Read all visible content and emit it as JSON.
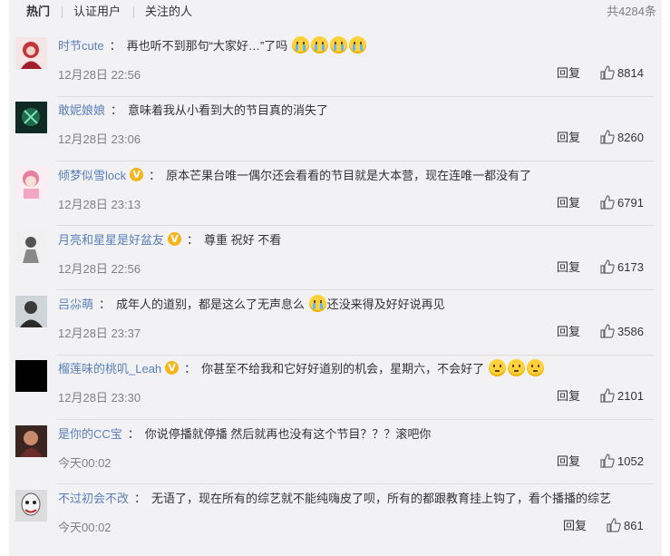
{
  "tabs": {
    "hot": "热门",
    "verified": "认证用户",
    "following": "关注的人",
    "total": "共4284条"
  },
  "icons": {
    "vip": "vip-badge-icon",
    "cry": "crying-face-emoji",
    "think": "thinking-face-emoji",
    "like": "thumbs-up-icon"
  },
  "colors": {
    "username": "#5a7fb8",
    "vip": "#f5b41a",
    "background": "#f2f2f5"
  },
  "reply_label": "回复",
  "comments": [
    {
      "user": "时节cute",
      "text_before": "再也听不到那句“大家好…”了吗",
      "text_after": "",
      "time": "12月28日 22:56",
      "likes": "8814"
    },
    {
      "user": "敢妮娘娘",
      "text_before": "意味着我从小看到大的节目真的消失了",
      "text_after": "",
      "time": "12月28日 23:06",
      "likes": "8260"
    },
    {
      "user": "倾梦似雪lock",
      "text_before": "原本芒果台唯一偶尔还会看看的节目就是大本营，现在连唯一都没有了",
      "text_after": "",
      "time": "12月28日 23:13",
      "likes": "6791"
    },
    {
      "user": "月亮和星星是好盆友",
      "text_before": "尊重 祝好 不看",
      "text_after": "",
      "time": "12月28日 22:56",
      "likes": "6173"
    },
    {
      "user": "吕尛萌",
      "text_before": "成年人的道别，都是这么了无声息么",
      "text_after": "还没来得及好好说再见",
      "time": "12月28日 23:37",
      "likes": "3586"
    },
    {
      "user": "榴莲味的桃叽_Leah",
      "text_before": "你甚至不给我和它好好道别的机会，星期六，不会好了",
      "text_after": "",
      "time": "12月28日 23:30",
      "likes": "2101"
    },
    {
      "user": "是你的CC宝",
      "text_before": "你说停播就停播 然后就再也没有这个节目？？？滚吧你",
      "text_after": "",
      "time": "今天00:02",
      "likes": "1052"
    },
    {
      "user": "不过初会不改",
      "text_before": "无语了，现在所有的综艺就不能纯嗨皮了呗，所有的都跟教育挂上钩了，看个播播的综艺",
      "text_after": "",
      "time": "今天00:02",
      "likes": "861"
    }
  ]
}
